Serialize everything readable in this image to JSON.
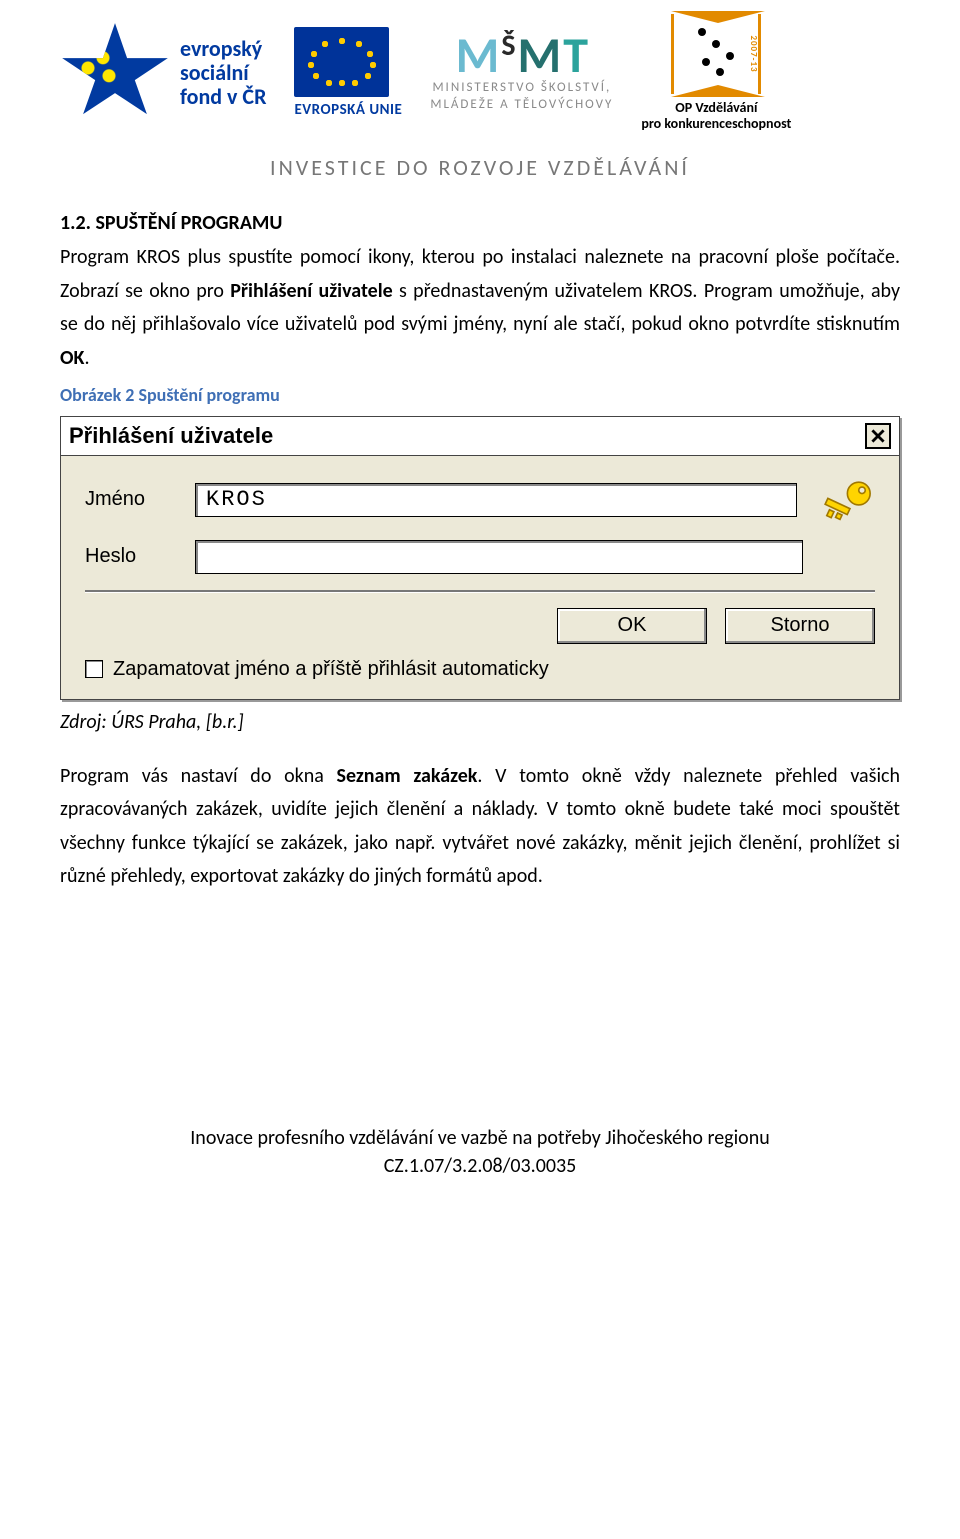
{
  "header": {
    "esf_line1": "evropský",
    "esf_line2": "sociální",
    "esf_line3": "fond v ČR",
    "eu_label": "EVROPSKÁ UNIE",
    "msmt_line1": "MINISTERSTVO ŠKOLSTVÍ,",
    "msmt_line2": "MLÁDEŽE A TĚLOVÝCHOVY",
    "opvk_side": "2007-13",
    "opvk_line1": "OP Vzdělávání",
    "opvk_line2": "pro konkurenceschopnost",
    "invest": "INVESTICE DO ROZVOJE VZDĚLÁVÁNÍ"
  },
  "body": {
    "section_title": "1.2. SPUŠTĚNÍ PROGRAMU",
    "p1_a": "Program KROS plus spustíte pomocí ikony, kterou po instalaci naleznete na pracovní ploše počítače. Zobrazí se okno pro ",
    "p1_bold1": "Přihlášení uživatele",
    "p1_b": " s přednastaveným uživatelem KROS. Program umožňuje, aby se do něj přihlašovalo více uživatelů pod svými jmény, nyní ale stačí, pokud okno potvrdíte stisknutím ",
    "p1_bold2": "OK",
    "p1_c": ".",
    "fig_caption": "Obrázek 2 Spuštění programu",
    "fig_source": "Zdroj: ÚRS Praha, [b.r.]",
    "p2_a": "Program vás nastaví do okna ",
    "p2_bold": "Seznam zakázek",
    "p2_b": ". V tomto okně vždy naleznete přehled vašich zpracovávaných zakázek, uvidíte jejich členění a náklady. V tomto okně budete také moci spouštět všechny funkce týkající se zakázek, jako např. vytvářet nové zakázky, měnit jejich členění, prohlížet si různé přehledy, exportovat zakázky do jiných formátů apod."
  },
  "dialog": {
    "title": "Přihlášení uživatele",
    "label_name": "Jméno",
    "label_pass": "Heslo",
    "value_name": "KROS",
    "value_pass": "",
    "btn_ok": "OK",
    "btn_cancel": "Storno",
    "remember": "Zapamatovat jméno a příště přihlásit automaticky"
  },
  "footer": {
    "line1": "Inovace profesního vzdělávání ve vazbě na potřeby Jihočeského regionu",
    "line2": "CZ.1.07/3.2.08/03.0035"
  }
}
